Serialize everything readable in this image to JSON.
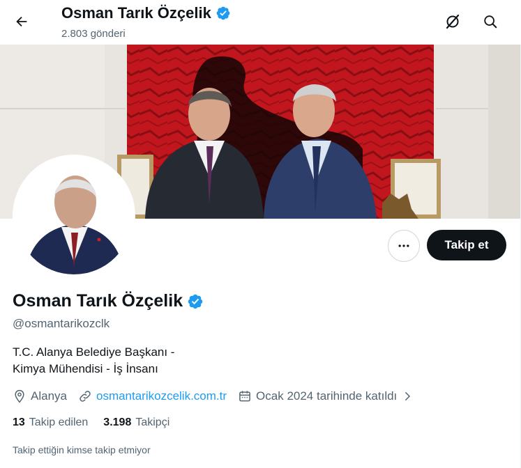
{
  "header": {
    "title": "Osman Tarık Özçelik",
    "subtitle": "2.803 gönderi"
  },
  "profile": {
    "name": "Osman Tarık Özçelik",
    "handle": "@osmantarikozclk",
    "bio_line1": "T.C. Alanya Belediye Başkanı -",
    "bio_line2": "Kimya Mühendisi - İş İnsanı",
    "location": "Alanya",
    "website": "osmantarikozcelik.com.tr",
    "joined": "Ocak 2024 tarihinde katıldı"
  },
  "stats": {
    "following_count": "13",
    "following_label": "Takip edilen",
    "followers_count": "3.198",
    "followers_label": "Takipçi"
  },
  "actions": {
    "follow_label": "Takip et"
  },
  "footer_note": "Takip ettiğin kimse takip etmiyor",
  "colors": {
    "accent": "#1d9bf0",
    "verified": "#1d9bf0",
    "follow_button": "#0f1419",
    "banner_red": "#c0151b"
  },
  "icons": [
    "back-arrow-icon",
    "grok-icon",
    "search-icon",
    "verified-badge-icon",
    "more-icon",
    "location-icon",
    "link-icon",
    "calendar-icon",
    "chevron-right-icon"
  ]
}
